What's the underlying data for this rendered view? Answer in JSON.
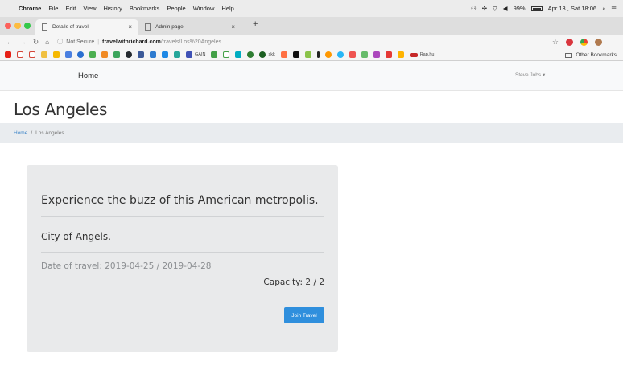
{
  "menubar": {
    "apple": "",
    "app": "Chrome",
    "items": [
      "File",
      "Edit",
      "View",
      "History",
      "Bookmarks",
      "People",
      "Window",
      "Help"
    ],
    "battery": "99%",
    "clock": "Apr 13., Sat 18:06"
  },
  "tabs": [
    {
      "title": "Details of travel"
    },
    {
      "title": "Admin page"
    }
  ],
  "newtab_label": "+",
  "address": {
    "security": "Not Secure",
    "host": "travelwithrichard.com",
    "path": "/travels/Los%20Angeles"
  },
  "bookmarks": {
    "gain_label": "GAIN",
    "skk_label": "skk",
    "rap_label": "Rap.hu",
    "other": "Other Bookmarks"
  },
  "navbar": {
    "home": "Home",
    "user": "Steve Jobs"
  },
  "page": {
    "title": "Los Angeles"
  },
  "breadcrumb": {
    "home": "Home",
    "separator": "/",
    "current": "Los Angeles"
  },
  "travel": {
    "lead": "Experience the buzz of this American metropolis.",
    "subtitle": "City of Angels.",
    "date": "Date of travel: 2019-04-25 / 2019-04-28",
    "capacity": "Capacity: 2 / 2",
    "join_label": "Join Travel"
  },
  "colors": {
    "primary": "#2f8fdd",
    "link": "#3f86c8",
    "card_bg": "#e9eaeb",
    "breadcrumb_bg": "#e9ecef"
  }
}
